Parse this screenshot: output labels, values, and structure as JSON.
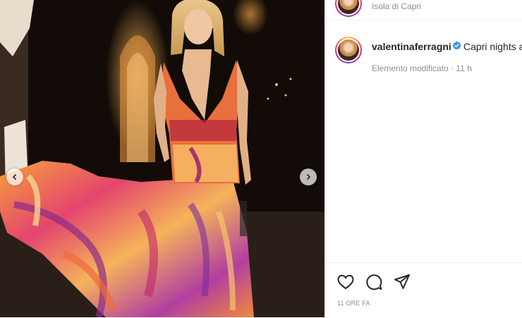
{
  "post": {
    "location": "Isola di Capri",
    "username": "valentinaferragni",
    "verified": true,
    "caption": "Capri nights a",
    "edited_label": "Elemento modificato",
    "age": "11 h",
    "timestamp": "11 ORE FA"
  },
  "icons": {
    "prev": "chevron-left-icon",
    "next": "chevron-right-icon",
    "like": "heart-icon",
    "comment": "comment-icon",
    "share": "send-icon"
  },
  "colors": {
    "verified": "#3897f0",
    "text_primary": "#262626",
    "text_secondary": "#8e8e8e"
  }
}
